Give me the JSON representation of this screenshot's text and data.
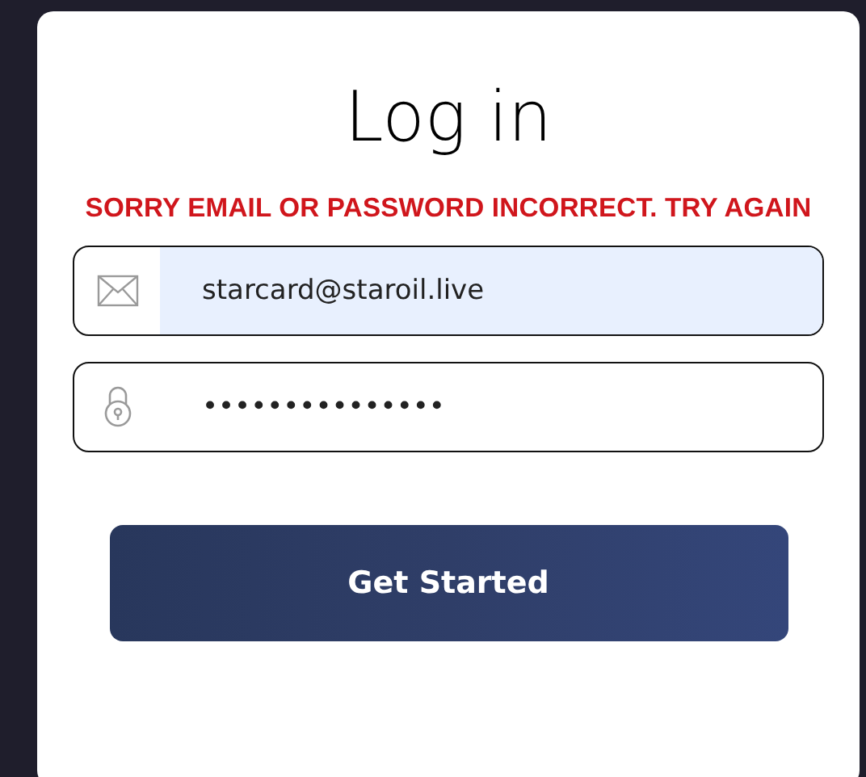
{
  "title": "Log in",
  "error": "SORRY EMAIL OR PASSWORD INCORRECT. TRY AGAIN",
  "fields": [
    {
      "kind": "email",
      "value": "starcard@staroil.live",
      "autofilled": true
    },
    {
      "kind": "password",
      "value": "•••••••••••••••",
      "autofilled": false
    }
  ],
  "button": "Get Started"
}
